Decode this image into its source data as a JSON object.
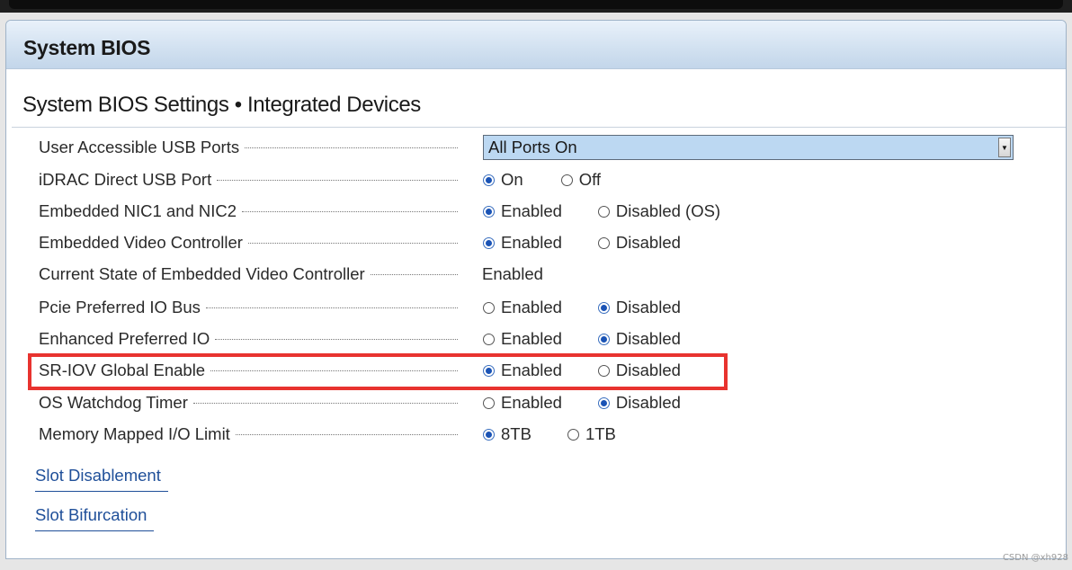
{
  "window": {
    "title": "System BIOS",
    "section_title": "System BIOS Settings • Integrated Devices"
  },
  "settings": [
    {
      "label": "User Accessible USB Ports",
      "type": "select",
      "value": "All Ports On"
    },
    {
      "label": "iDRAC Direct USB Port",
      "type": "radio",
      "options": [
        "On",
        "Off"
      ],
      "selected": "On"
    },
    {
      "label": "Embedded NIC1 and NIC2",
      "type": "radio",
      "options": [
        "Enabled",
        "Disabled (OS)"
      ],
      "selected": "Enabled"
    },
    {
      "label": "Embedded Video Controller",
      "type": "radio",
      "options": [
        "Enabled",
        "Disabled"
      ],
      "selected": "Enabled"
    },
    {
      "label": "Current State of Embedded Video Controller",
      "type": "static",
      "value": "Enabled"
    },
    {
      "label": "Pcie Preferred IO Bus",
      "type": "radio",
      "options": [
        "Enabled",
        "Disabled"
      ],
      "selected": "Disabled"
    },
    {
      "label": "Enhanced Preferred IO",
      "type": "radio",
      "options": [
        "Enabled",
        "Disabled"
      ],
      "selected": "Disabled"
    },
    {
      "label": "SR-IOV Global Enable",
      "type": "radio",
      "options": [
        "Enabled",
        "Disabled"
      ],
      "selected": "Enabled"
    },
    {
      "label": "OS Watchdog Timer",
      "type": "radio",
      "options": [
        "Enabled",
        "Disabled"
      ],
      "selected": "Disabled"
    },
    {
      "label": "Memory Mapped I/O Limit",
      "type": "radio",
      "options": [
        "8TB",
        "1TB"
      ],
      "selected": "8TB"
    }
  ],
  "links": {
    "slot_disablement": "Slot Disablement",
    "slot_bifurcation": "Slot Bifurcation"
  },
  "watermark": "CSDN @xh928",
  "colors": {
    "highlight": "#e8332f",
    "radio_selected": "#1a53b5",
    "link": "#1f4f99",
    "select_bg": "#bcd8f2"
  }
}
